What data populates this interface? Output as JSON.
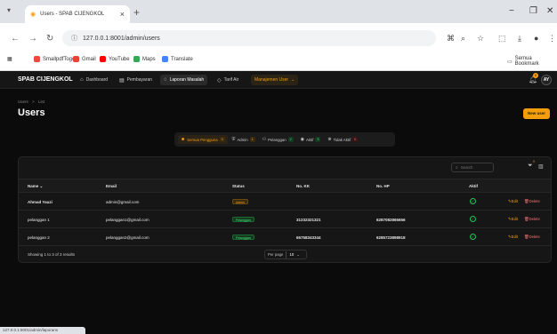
{
  "browser": {
    "tab_title": "Users - SPAB CIJENGKOL",
    "url": "127.0.0.1:8001/admin/users",
    "bookmarks": [
      "SmallpdfTogo",
      "Gmail",
      "YouTube",
      "Maps",
      "Translate"
    ],
    "all_bookmarks": "Semua Bookmark",
    "status_url": "127.0.0.1:8001/admin/laporans"
  },
  "colors": {
    "accent": "#f59e0b",
    "success": "#22c55e",
    "danger": "#f87171"
  },
  "nav": {
    "brand": "SPAB CIJENGKOL",
    "items": [
      {
        "label": "Dashboard",
        "icon": "home-icon"
      },
      {
        "label": "Pembayaran",
        "icon": "receipt-icon"
      },
      {
        "label": "Laporan Masalah",
        "icon": "report-icon"
      },
      {
        "label": "Tarif Air",
        "icon": "tag-icon"
      },
      {
        "label": "Manajemen User",
        "icon": "chevron-down-icon"
      }
    ],
    "notif_count": "0",
    "avatar_initials": "AY"
  },
  "page": {
    "breadcrumb_root": "Users",
    "breadcrumb_sep": ">",
    "breadcrumb_current": "List",
    "title": "Users",
    "new_button": "New user"
  },
  "filters": [
    {
      "label": "Semua Pengguna",
      "count": "3"
    },
    {
      "label": "Admin",
      "count": "1"
    },
    {
      "label": "Pelanggan",
      "count": "2"
    },
    {
      "label": "Aktif",
      "count": "3"
    },
    {
      "label": "Tidak Aktif",
      "count": "0"
    }
  ],
  "table": {
    "search_placeholder": "Search",
    "filter_count": "0",
    "columns": [
      "Name",
      "Email",
      "Status",
      "No. KK",
      "No. HP",
      "Aktif"
    ],
    "rows": [
      {
        "name": "Ahmad Yauzi",
        "email": "admin@gmail.com",
        "status": "Admin",
        "kk": "",
        "hp": "",
        "aktif": "true"
      },
      {
        "name": "pelanggan 1",
        "email": "pelanggan1@gmail.com",
        "status": "Pelanggan",
        "kk": "31232321321",
        "hp": "6287082865656",
        "aktif": "true"
      },
      {
        "name": "pelanggan 2",
        "email": "pelanggan2@gmail.com",
        "status": "Pelanggan",
        "kk": "65758343344",
        "hp": "6285723898918",
        "aktif": "true"
      }
    ],
    "edit_label": "Edit",
    "delete_label": "Delete",
    "showing": "Showing 1 to 3 of 3 results",
    "per_page_label": "Per page",
    "per_page_value": "10"
  }
}
